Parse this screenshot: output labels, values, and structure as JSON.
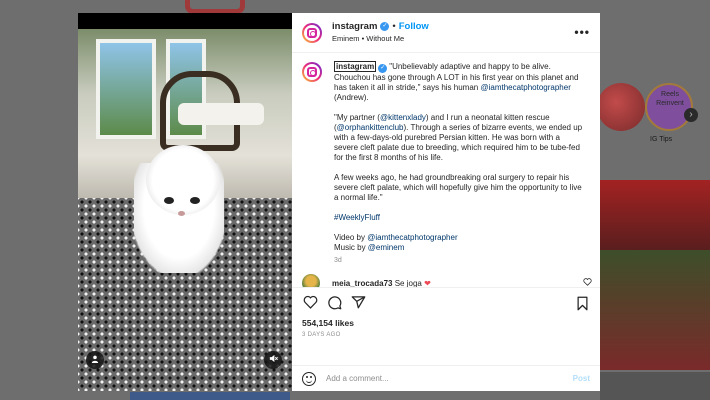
{
  "post": {
    "username": "instagram",
    "follow_label": "Follow",
    "subtitle": "Eminem • Without Me",
    "more_label": "•••",
    "caption_paragraphs": [
      [
        "\"Unbelievably adaptive and happy to be alive. Chouchou has gone through A LOT in his first year on this planet and has taken it all in stride,\" says his human ",
        {
          "link": "@iamthecatphotographer"
        },
        " (Andrew)."
      ],
      [
        "\"My partner (",
        {
          "link": "@kittenxlady"
        },
        ") and I run a neonatal kitten rescue (",
        {
          "link": "@orphankittenclub"
        },
        "). Through a series of bizarre events, we ended up with a few-days-old purebred Persian kitten. He was born with a severe cleft palate due to breeding, which required him to be tube-fed for the first 8 months of his life."
      ],
      [
        "A few weeks ago, he had groundbreaking oral surgery to repair his severe cleft palate, which will hopefully give him the opportunity to live a normal life.\""
      ],
      [
        {
          "link": "#WeeklyFluff"
        }
      ],
      [
        "Video by ",
        {
          "link": "@iamthecatphotographer"
        },
        "\nMusic by ",
        {
          "link": "@eminem"
        }
      ]
    ],
    "caption_age": "3d",
    "comments": [
      {
        "user": "meia_trocada73",
        "text": "Se joga",
        "emoji": "heart"
      }
    ],
    "likes": "554,154 likes",
    "date": "3 DAYS AGO",
    "comment_placeholder": "Add a comment...",
    "post_label": "Post"
  },
  "background": {
    "story_label": "Reels Reinvent",
    "story_caption": "IG Tips",
    "arrow": "›"
  },
  "colors": {
    "accent": "#0095f6",
    "verified": "#3897f0",
    "heart": "#ed4956",
    "link": "#00376b"
  }
}
